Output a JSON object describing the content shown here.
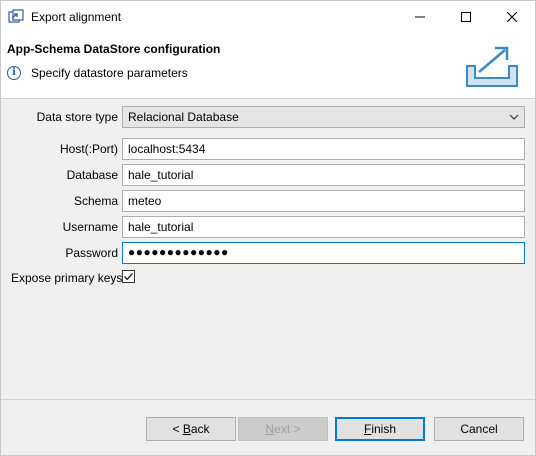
{
  "window": {
    "title": "Export alignment",
    "controls": {
      "minimize": "minimize",
      "maximize": "maximize",
      "close": "close"
    }
  },
  "header": {
    "title": "App-Schema DataStore configuration",
    "message": "Specify datastore parameters",
    "message_icon": "info-icon",
    "graphic_icon": "export-tray-icon"
  },
  "form": {
    "data_store_type": {
      "label": "Data store type",
      "value": "Relacional Database"
    },
    "host": {
      "label": "Host(:Port)",
      "value": "localhost:5434"
    },
    "database": {
      "label": "Database",
      "value": "hale_tutorial"
    },
    "schema": {
      "label": "Schema",
      "value": "meteo"
    },
    "username": {
      "label": "Username",
      "value": "hale_tutorial"
    },
    "password": {
      "label": "Password",
      "value": "●●●●●●●●●●●●●"
    },
    "expose_primary_keys": {
      "label": "Expose primary keys",
      "checked": true
    }
  },
  "buttons": {
    "back": {
      "prefix": "< ",
      "mnemonic": "B",
      "rest": "ack"
    },
    "next": {
      "mnemonic": "N",
      "rest": "ext >"
    },
    "finish": {
      "mnemonic": "F",
      "rest": "inish"
    },
    "cancel": "Cancel"
  },
  "colors": {
    "accent": "#0078d7",
    "info": "#1c5ea8",
    "graphic": "#3c8ac4"
  }
}
